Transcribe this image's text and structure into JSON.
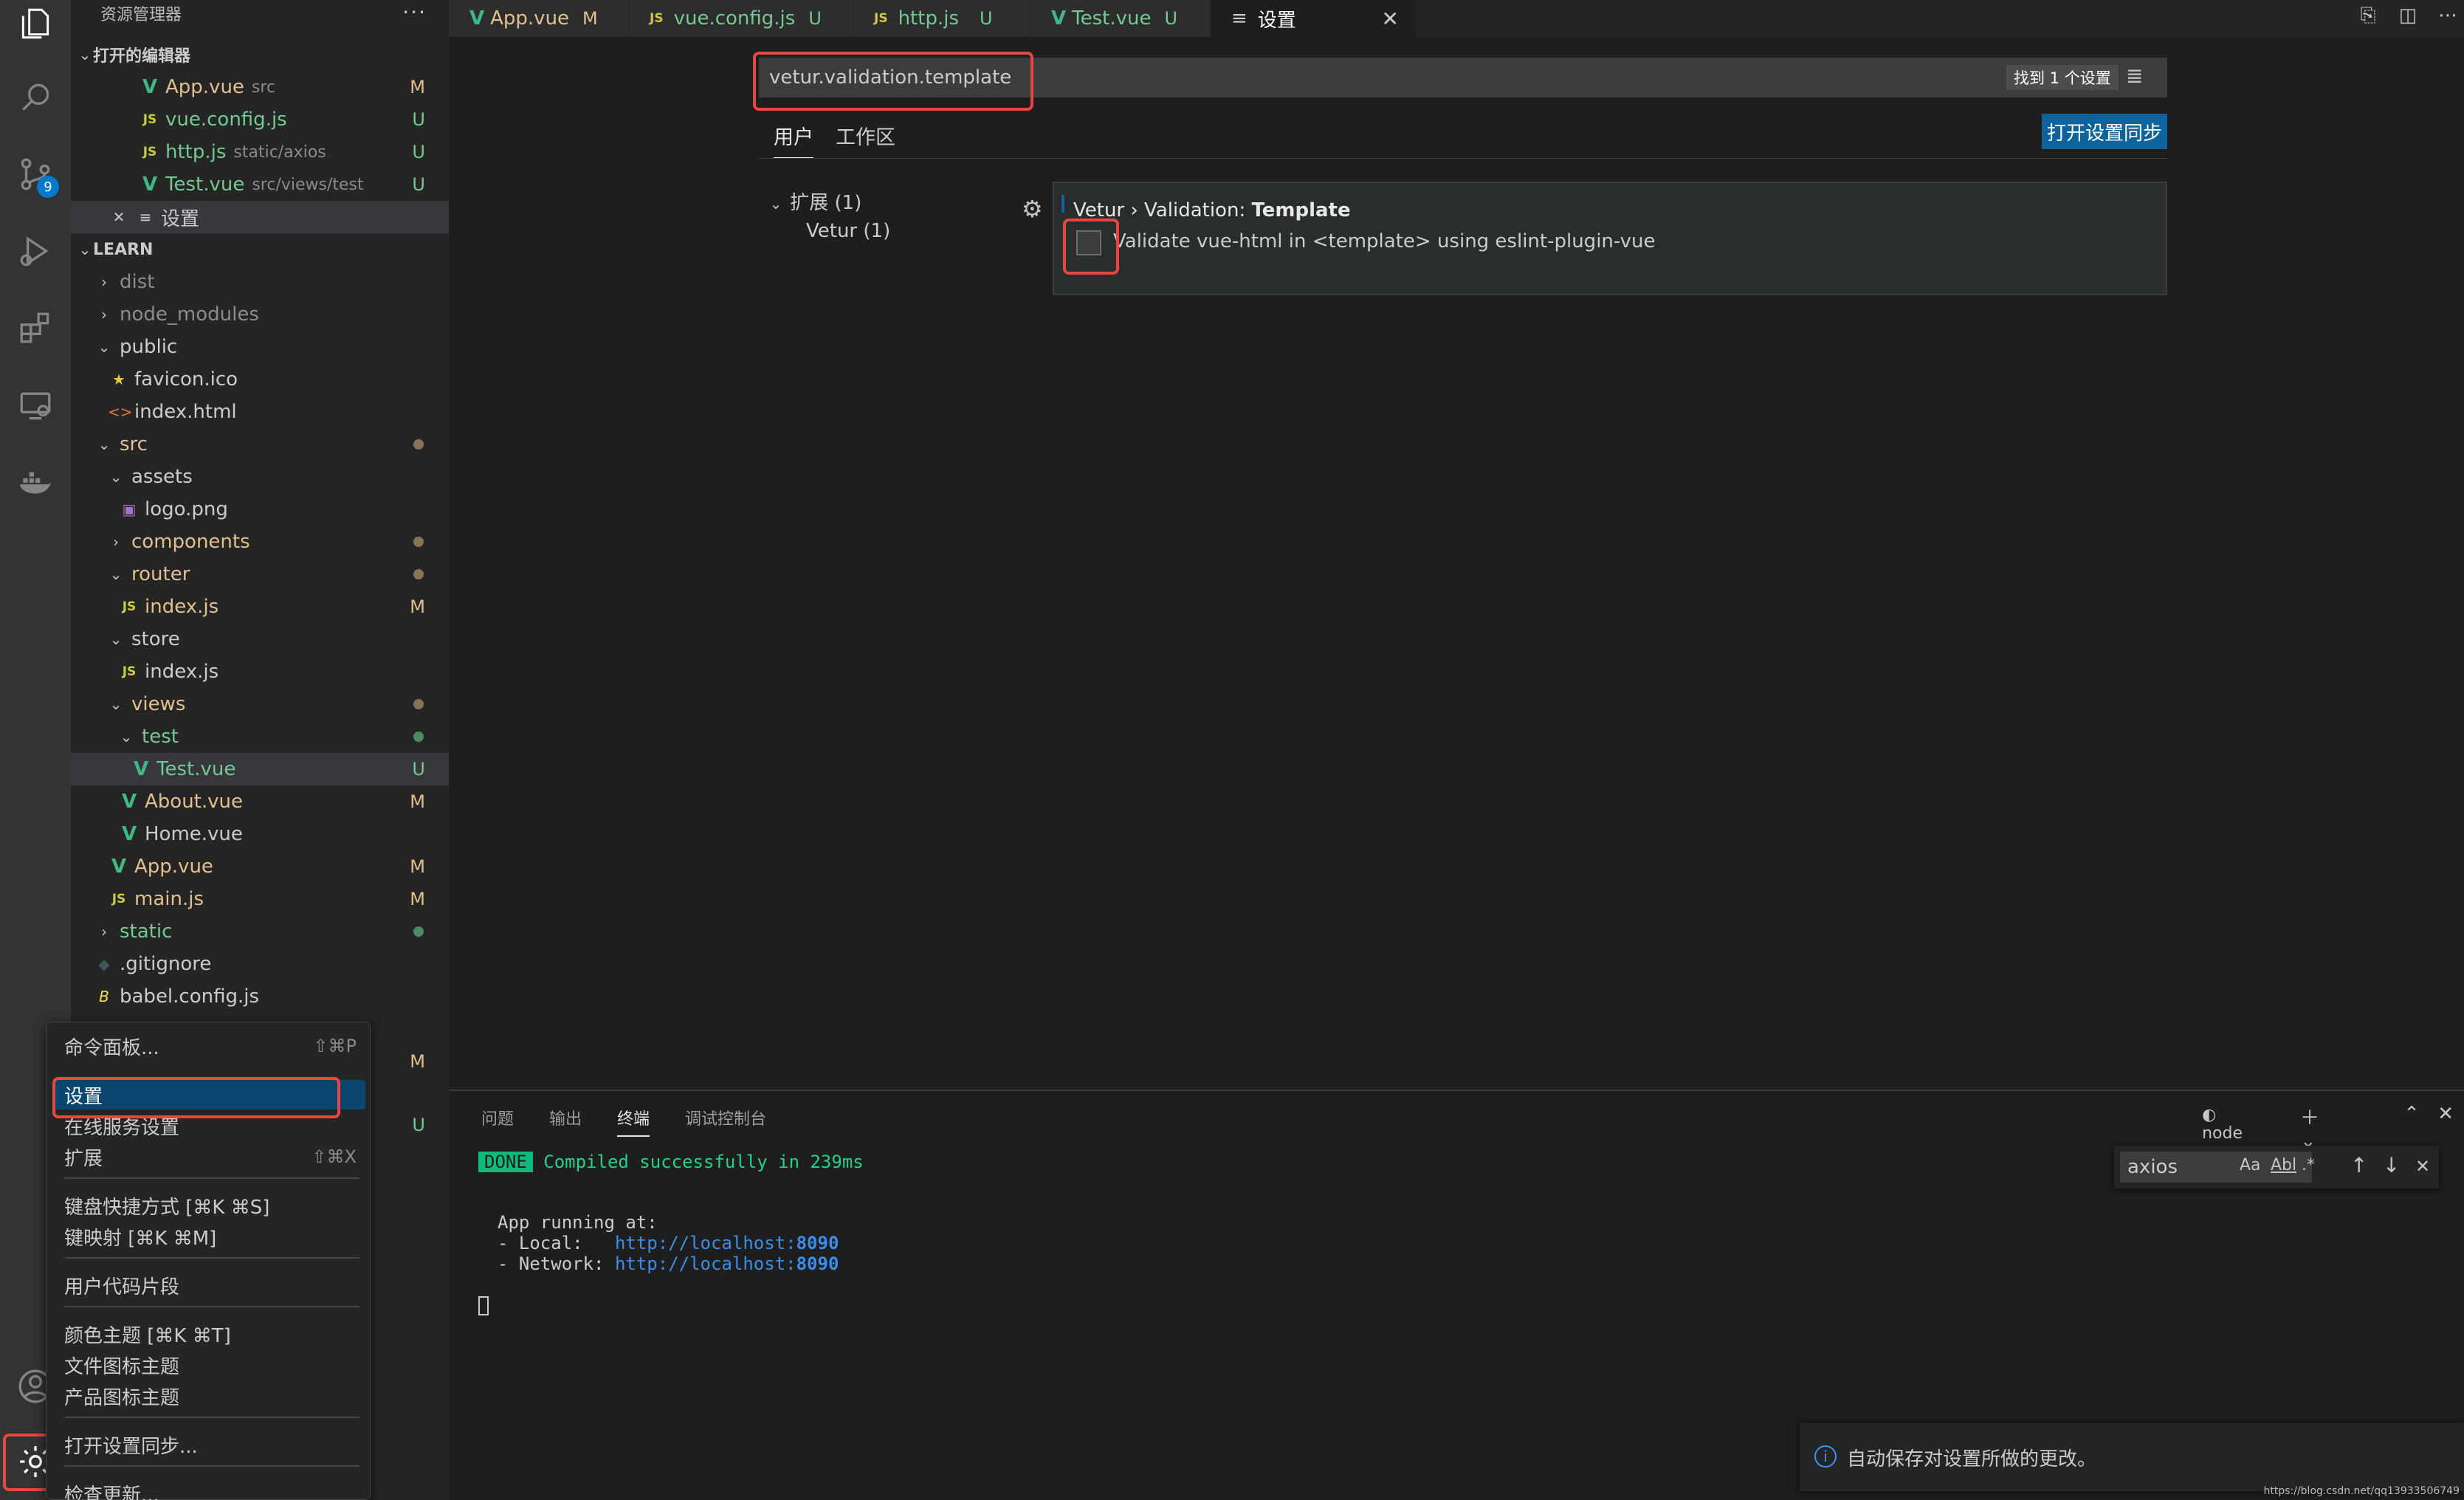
{
  "activity_bar": {
    "icons": [
      "explorer-icon",
      "search-icon",
      "source-control-icon",
      "run-debug-icon",
      "extensions-icon",
      "remote-explorer-icon",
      "docker-icon",
      "account-icon",
      "manage-gear-icon"
    ],
    "scm_badge": "9"
  },
  "sidebar": {
    "title": "资源管理器",
    "more": "···",
    "open_editors_title": "打开的编辑器",
    "open_editors": [
      {
        "name": "App.vue",
        "hint": "src",
        "status": "M",
        "type": "vue"
      },
      {
        "name": "vue.config.js",
        "hint": "",
        "status": "U",
        "type": "js"
      },
      {
        "name": "http.js",
        "hint": "static/axios",
        "status": "U",
        "type": "js"
      },
      {
        "name": "Test.vue",
        "hint": "src/views/test",
        "status": "U",
        "type": "vue"
      },
      {
        "name": "设置",
        "hint": "",
        "status": "",
        "type": "settings"
      }
    ],
    "project_title": "LEARN",
    "files": {
      "dist": "dist",
      "node_modules": "node_modules",
      "public": "public",
      "favicon": "favicon.ico",
      "index_html": "index.html",
      "src": "src",
      "assets": "assets",
      "logo": "logo.png",
      "components": "components",
      "router": "router",
      "router_index": "index.js",
      "router_index_status": "M",
      "store": "store",
      "store_index": "index.js",
      "views": "views",
      "test": "test",
      "test_vue": "Test.vue",
      "test_vue_status": "U",
      "about_vue": "About.vue",
      "about_vue_status": "M",
      "home_vue": "Home.vue",
      "app_vue": "App.vue",
      "app_vue_status": "M",
      "main_js": "main.js",
      "main_js_status": "M",
      "static": "static",
      "gitignore": ".gitignore",
      "babel": "babel.config.js",
      "hidden_status_1": "M",
      "hidden_status_2": "U"
    }
  },
  "tabs": [
    {
      "label": "App.vue",
      "status": "M",
      "type": "vue"
    },
    {
      "label": "vue.config.js",
      "status": "U",
      "type": "js"
    },
    {
      "label": "http.js",
      "status": "U",
      "type": "js"
    },
    {
      "label": "Test.vue",
      "status": "U",
      "type": "vue"
    },
    {
      "label": "设置",
      "status": "",
      "type": "settings"
    }
  ],
  "settings": {
    "search_value": "vetur.validation.template",
    "found": "找到 1 个设置",
    "scope_tabs": [
      "用户",
      "工作区"
    ],
    "sync_button": "打开设置同步",
    "toc": [
      "扩展 (1)",
      "Vetur (1)"
    ],
    "setting_title_prefix": "Vetur › Validation: ",
    "setting_title_name": "Template",
    "setting_description": "Validate vue-html in <template> using eslint-plugin-vue",
    "checked": false
  },
  "panel": {
    "tabs": [
      "问题",
      "输出",
      "终端",
      "调试控制台"
    ],
    "shell": "node",
    "terminal": {
      "done": "DONE",
      "compiled": "Compiled successfully in 239ms",
      "running": "App running at:",
      "local_label": "- Local:   ",
      "local_url": "http://localhost:",
      "local_port": "8090",
      "network_label": "- Network: ",
      "network_url": "http://localhost:",
      "network_port": "8090"
    },
    "find": {
      "value": "axios",
      "opt_case": "Aa",
      "opt_word": "Abl",
      "opt_regex": ".*"
    }
  },
  "menu": {
    "items": [
      {
        "label": "命令面板...",
        "shortcut": "⇧⌘P"
      },
      {
        "label": "设置",
        "shortcut": ""
      },
      {
        "label": "在线服务设置",
        "shortcut": ""
      },
      {
        "label": "扩展",
        "shortcut": "⇧⌘X"
      },
      {
        "label": "键盘快捷方式 [⌘K ⌘S]",
        "shortcut": ""
      },
      {
        "label": "键映射 [⌘K ⌘M]",
        "shortcut": ""
      },
      {
        "label": "用户代码片段",
        "shortcut": ""
      },
      {
        "label": "颜色主题 [⌘K ⌘T]",
        "shortcut": ""
      },
      {
        "label": "文件图标主题",
        "shortcut": ""
      },
      {
        "label": "产品图标主题",
        "shortcut": ""
      },
      {
        "label": "打开设置同步...",
        "shortcut": ""
      },
      {
        "label": "检查更新...",
        "shortcut": ""
      }
    ]
  },
  "notification": "自动保存对设置所做的更改。",
  "watermark": "https://blog.csdn.net/qq13933506749",
  "colors": {
    "accent": "#007acc",
    "highlight_red": "#e8473f",
    "vue_green": "#41b883",
    "modified": "#e2c08d",
    "untracked": "#73c991"
  }
}
